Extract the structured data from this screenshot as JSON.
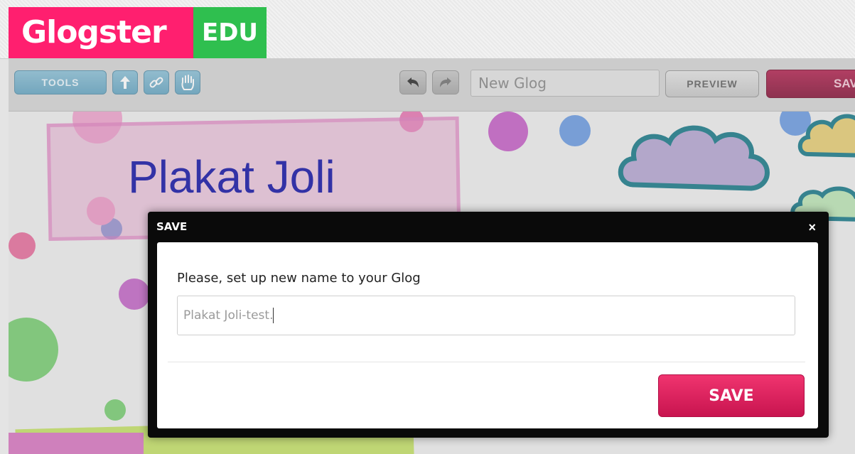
{
  "brand": {
    "name": "Glogster",
    "edition": "EDU"
  },
  "toolbar": {
    "tools_label": "TOOLS",
    "name_field_value": "New Glog",
    "preview_label": "PREVIEW",
    "save_label": "SAV"
  },
  "canvas": {
    "title": "Plakat Joli"
  },
  "dialog": {
    "title": "SAVE",
    "close_symbol": "×",
    "prompt": "Please, set up new name to your Glog",
    "input_value": "Plakat Joli-test.",
    "save_label": "SAVE"
  },
  "colors": {
    "brand_pink": "#ff1f6f",
    "brand_green": "#2fbf4f",
    "tool_blue": "#6aa8c4",
    "save_crimson": "#c8144f",
    "title_blue": "#1a1aa8"
  },
  "icons": [
    "arrow-up-icon",
    "link-icon",
    "hand-icon",
    "undo-icon",
    "redo-icon",
    "close-icon"
  ]
}
